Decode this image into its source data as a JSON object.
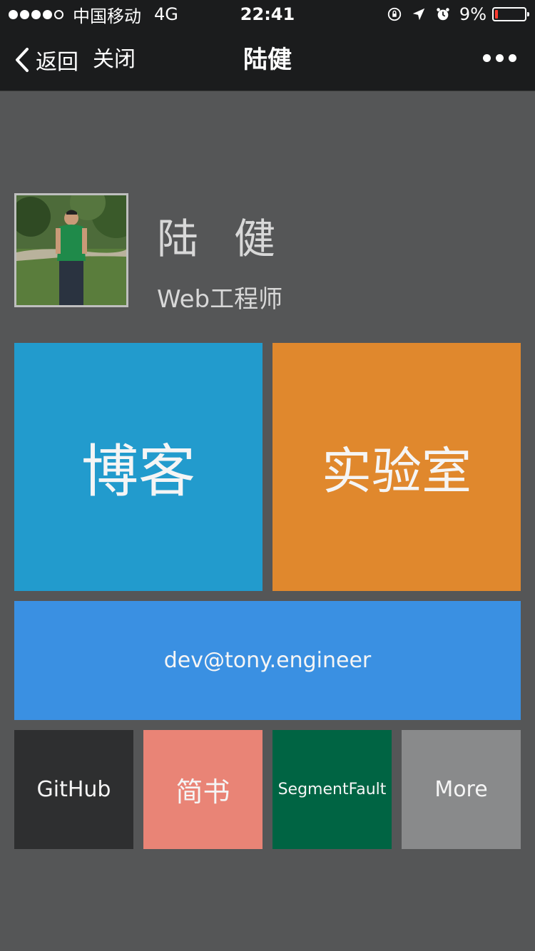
{
  "status_bar": {
    "carrier": "中国移动",
    "network": "4G",
    "time": "22:41",
    "battery": "9%",
    "battery_level": 0.09,
    "signal_bars": 4,
    "signal_total": 5,
    "icons": [
      "orientation-lock-icon",
      "location-icon",
      "alarm-icon"
    ]
  },
  "nav": {
    "back_label": "返回",
    "close_label": "关闭",
    "title": "陆健",
    "more_icon": "more-dots-icon"
  },
  "profile": {
    "name": "陆健",
    "title": "Web工程师"
  },
  "tiles": {
    "blog": "博客",
    "lab": "实验室",
    "email": "dev@tony.engineer",
    "github": "GitHub",
    "jianshu": "简书",
    "segmentfault": "SegmentFault",
    "more": "More"
  },
  "colors": {
    "background": "#555657",
    "navbar": "#1b1c1d",
    "blog": "#229bcd",
    "lab": "#e0882d",
    "email": "#3a90e2",
    "github": "#2e2f30",
    "jianshu": "#e98476",
    "segmentfault": "#006443",
    "more": "#898a8b"
  }
}
